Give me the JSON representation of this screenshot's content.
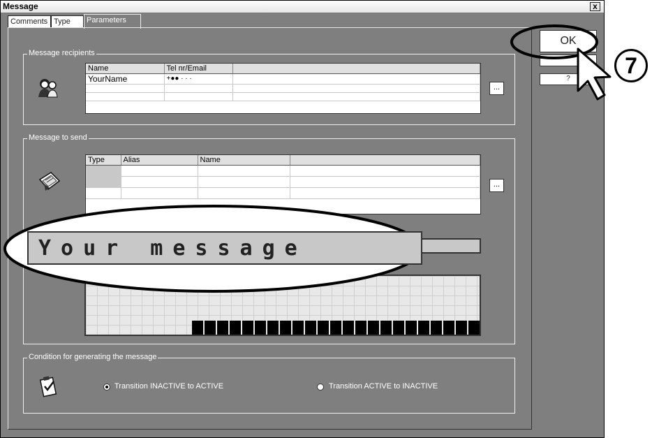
{
  "window": {
    "title": "Message",
    "close_label": "x"
  },
  "tabs": [
    {
      "label": "Comments"
    },
    {
      "label": "Type"
    },
    {
      "label": "Parameters"
    }
  ],
  "recipients": {
    "group_label": "Message recipients",
    "columns": [
      "Name",
      "Tel nr/Email"
    ],
    "rows": [
      {
        "name": "YourName",
        "contact": "+●● · · ·"
      }
    ],
    "browse_label": "..."
  },
  "message": {
    "group_label": "Message to send",
    "columns": [
      "Type",
      "Alias",
      "Name"
    ],
    "browse_label": "...",
    "text": "Your message"
  },
  "condition": {
    "group_label": "Condition for generating the message",
    "options": [
      {
        "label": "Transition INACTIVE to ACTIVE",
        "checked": true
      },
      {
        "label": "Transition ACTIVE to INACTIVE",
        "checked": false
      }
    ]
  },
  "buttons": {
    "ok_label": "OK",
    "help_label": "?"
  },
  "annotations": {
    "step_number": "7"
  }
}
